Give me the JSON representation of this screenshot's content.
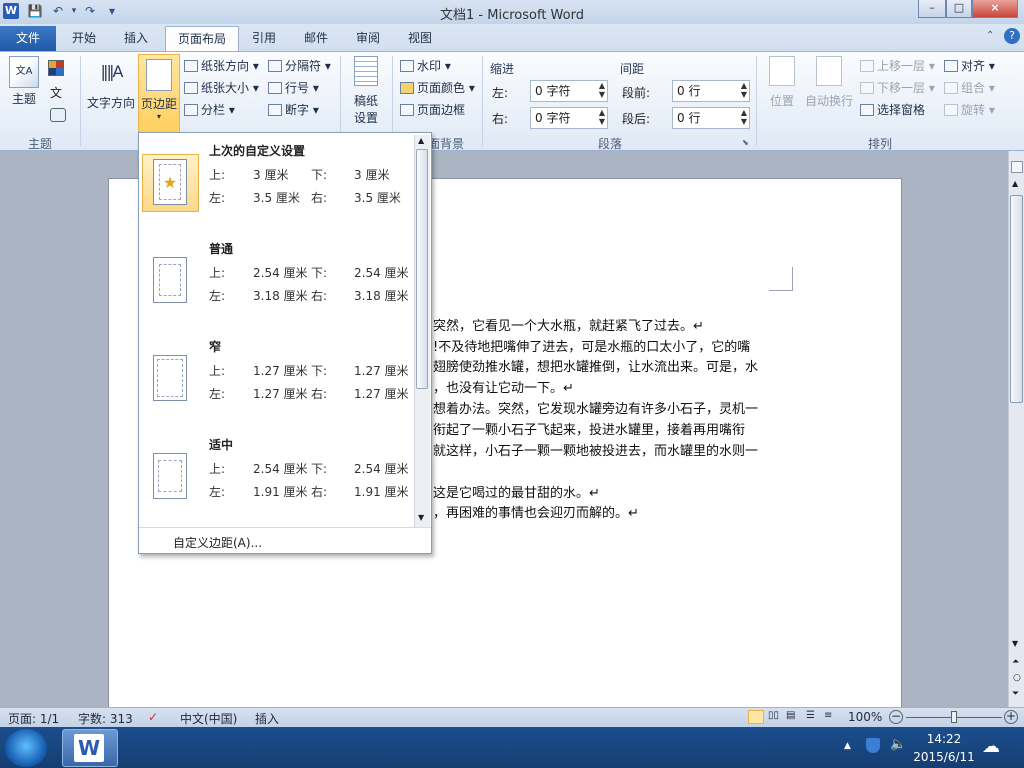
{
  "window": {
    "title": "文档1 - Microsoft Word",
    "word_icon": "W",
    "minimize": "–",
    "maximize": "□",
    "close": "×"
  },
  "quick_access": {
    "save": "💾",
    "undo": "↶",
    "redo": "↷",
    "customize": "▾"
  },
  "tabs": [
    {
      "label": "文件",
      "active": false
    },
    {
      "label": "开始",
      "active": false
    },
    {
      "label": "插入",
      "active": false
    },
    {
      "label": "页面布局",
      "active": true
    },
    {
      "label": "引用",
      "active": false
    },
    {
      "label": "邮件",
      "active": false
    },
    {
      "label": "审阅",
      "active": false
    },
    {
      "label": "视图",
      "active": false
    }
  ],
  "ribbon": {
    "themes_group": {
      "label": "主题",
      "theme_btn": "主题"
    },
    "page_setup": {
      "text_direction": "文字方向",
      "margins": "页边距",
      "orientation": "纸张方向",
      "size": "纸张大小",
      "columns": "分栏",
      "breaks": "分隔符",
      "line_numbers": "行号",
      "hyphenation": "断字"
    },
    "draft": {
      "label": "稿纸\n设置",
      "line1": "稿纸",
      "line2": "设置"
    },
    "page_background": {
      "label": "页面背景",
      "watermark": "水印",
      "page_color": "页面颜色",
      "page_borders": "页面边框"
    },
    "paragraph": {
      "label": "段落",
      "indent_title": "缩进",
      "spacing_title": "间距",
      "indent_left_label": "左:",
      "indent_left_value": "0 字符",
      "indent_right_label": "右:",
      "indent_right_value": "0 字符",
      "space_before_label": "段前:",
      "space_before_value": "0 行",
      "space_after_label": "段后:",
      "space_after_value": "0 行"
    },
    "arrange": {
      "label": "排列",
      "position": "位置",
      "wrap_text": "自动换行",
      "bring_forward": "上移一层",
      "send_backward": "下移一层",
      "selection_pane": "选择窗格",
      "align": "对齐",
      "group": "组合",
      "rotate": "旋转"
    }
  },
  "margins_dropdown": {
    "presets": [
      {
        "name": "上次的自定义设置",
        "top_label": "上:",
        "top": "3 厘米",
        "bottom_label": "下:",
        "bottom": "3 厘米",
        "left_label": "左:",
        "left": "3.5 厘米",
        "right_label": "右:",
        "right": "3.5 厘米",
        "highlighted": true
      },
      {
        "name": "普通",
        "top_label": "上:",
        "top": "2.54 厘米",
        "bottom_label": "下:",
        "bottom": "2.54 厘米",
        "left_label": "左:",
        "left": "3.18 厘米",
        "right_label": "右:",
        "right": "3.18 厘米"
      },
      {
        "name": "窄",
        "top_label": "上:",
        "top": "1.27 厘米",
        "bottom_label": "下:",
        "bottom": "1.27 厘米",
        "left_label": "左:",
        "left": "1.27 厘米",
        "right_label": "右:",
        "right": "1.27 厘米"
      },
      {
        "name": "适中",
        "top_label": "上:",
        "top": "2.54 厘米",
        "bottom_label": "下:",
        "bottom": "2.54 厘米",
        "left_label": "左:",
        "left": "1.91 厘米",
        "right_label": "右:",
        "right": "1.91 厘米"
      }
    ],
    "custom": "自定义边距(A)..."
  },
  "document": {
    "lines": [
      "突然，它看见一个大水瓶，就赶紧飞了过去。↵",
      "!不及待地把嘴伸了进去，可是水瓶的口太小了，它的嘴",
      "翅膀使劲推水罐，想把水罐推倒，让水流出来。可是，水",
      "，也没有让它动一下。↵",
      "想着办法。突然，它发现水罐旁边有许多小石子，灵机一",
      "衔起了一颗小石子飞起来，投进水罐里，接着再用嘴衔",
      "就这样，小石子一颗一颗地被投进去，而水罐里的水则一",
      "这是它喝过的最甘甜的水。↵",
      "，再困难的事情也会迎刃而解的。↵"
    ]
  },
  "status": {
    "page": "页面: 1/1",
    "words": "字数: 313",
    "language": "中文(中国)",
    "mode": "插入",
    "zoom": "100%"
  },
  "taskbar": {
    "time": "14:22",
    "date": "2015/6/11"
  }
}
